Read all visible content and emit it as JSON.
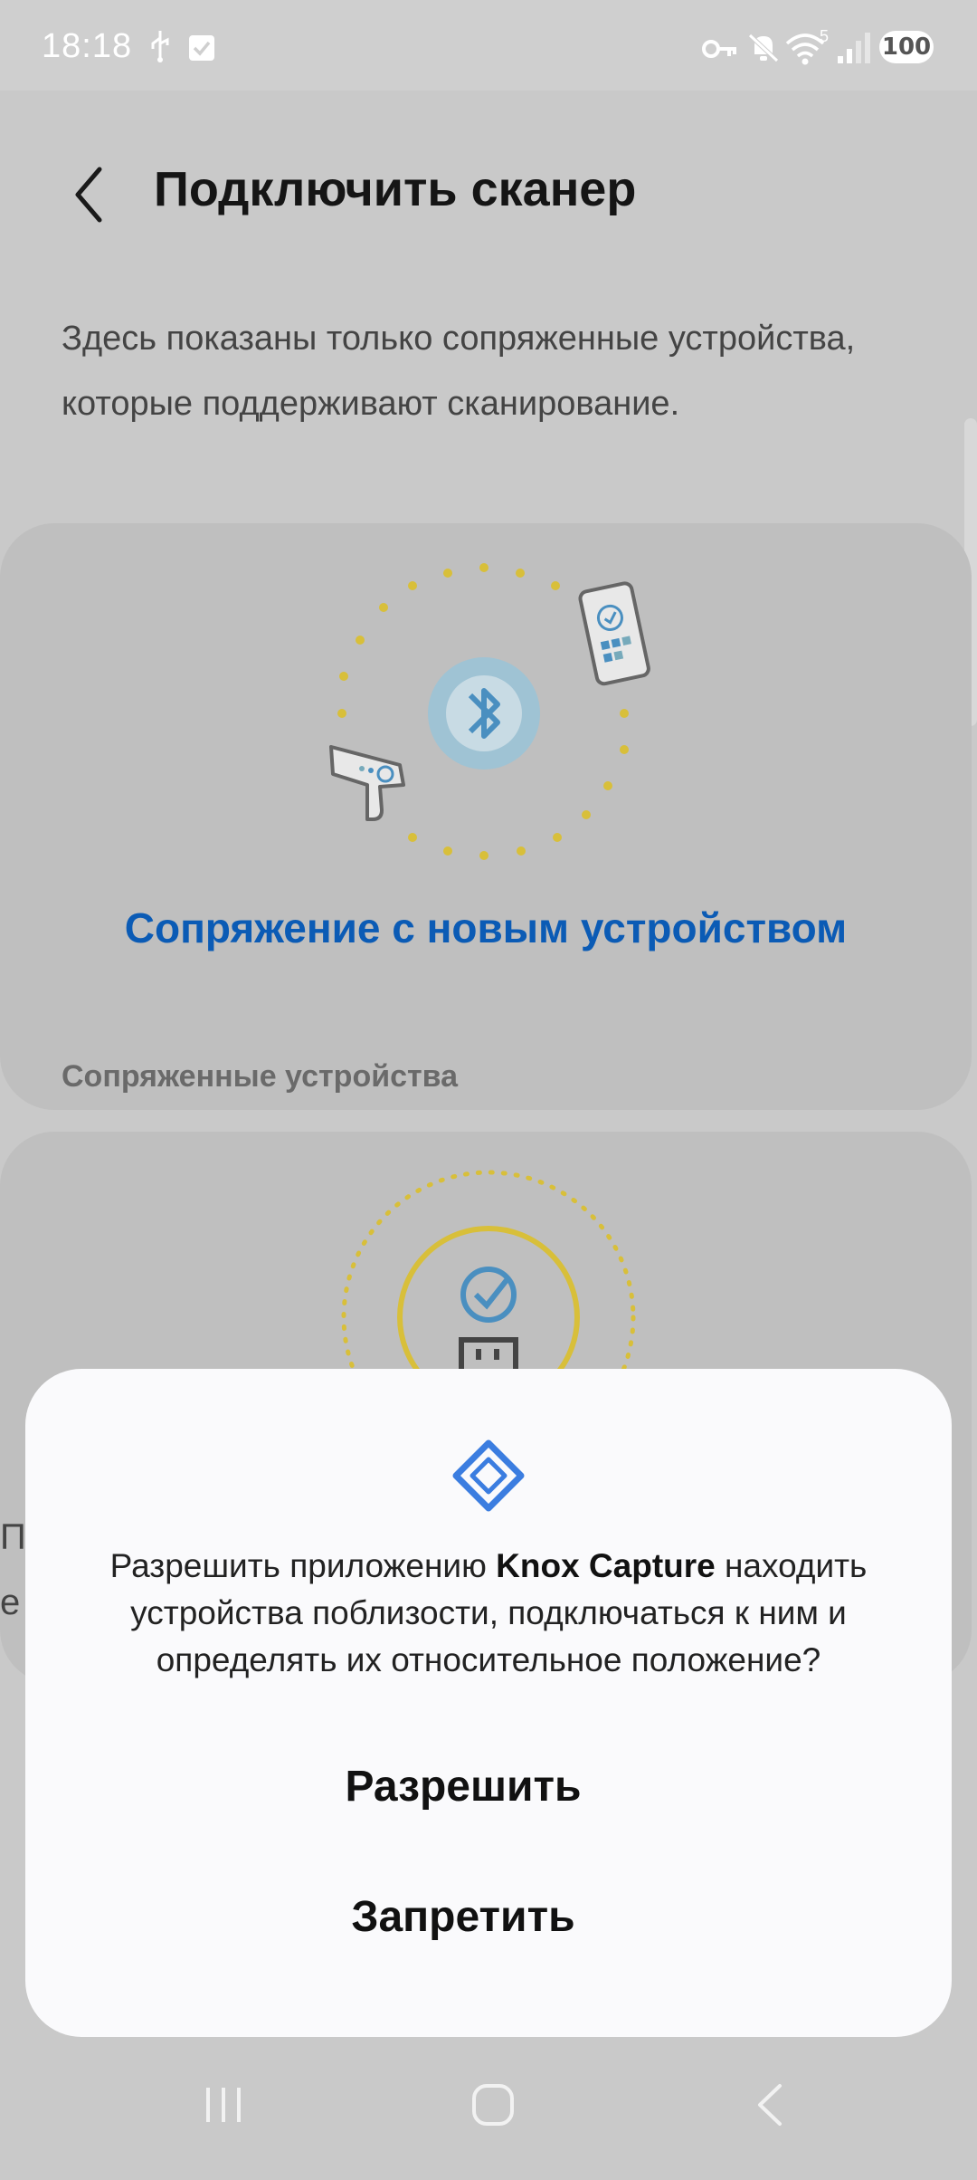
{
  "status_bar": {
    "time": "18:18",
    "wifi_badge": "5",
    "battery": "100",
    "icons": [
      "usb-icon",
      "checkbox-notification-icon",
      "vpn-key-icon",
      "mute-icon",
      "wifi-icon",
      "signal-icon",
      "battery-icon"
    ]
  },
  "header": {
    "title": "Подключить сканер"
  },
  "intro": {
    "text": "Здесь показаны только сопряженные устройства, которые поддерживают сканирование."
  },
  "pair_card": {
    "link": "Сопряжение с новым устройством"
  },
  "paired": {
    "section_label": "Сопряженные устройства",
    "partial_text_1": "П",
    "partial_text_2": "е"
  },
  "dialog": {
    "text_before": "Разрешить приложению ",
    "app_name": "Knox Capture",
    "text_after": " находить устройства поблизости, подключаться к ним и определять их относительное положение?",
    "allow_label": "Разрешить",
    "deny_label": "Запретить"
  },
  "nav_bar": {
    "icons": [
      "recent-apps-icon",
      "home-icon",
      "back-icon"
    ]
  },
  "colors": {
    "accent_blue": "#0b5bb5",
    "bluetooth_ring": "#9fc3d4",
    "dots_yellow": "#d8bf3a"
  }
}
